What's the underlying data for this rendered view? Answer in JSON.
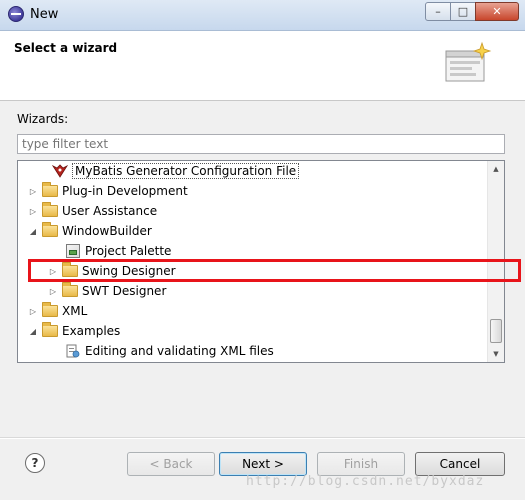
{
  "window": {
    "title": "New",
    "minimize_glyph": "–",
    "restore_glyph": "□",
    "close_glyph": "✕"
  },
  "header": {
    "title": "Select a wizard"
  },
  "wizards": {
    "label": "Wizards:",
    "filter_placeholder": "type filter text",
    "filter_value": ""
  },
  "tree": {
    "items": [
      {
        "label": "MyBatis Generator Configuration File",
        "icon": "mybatis-icon",
        "expander": "",
        "selected": true
      },
      {
        "label": "Plug-in Development",
        "icon": "folder-icon",
        "expander": "▷"
      },
      {
        "label": "User Assistance",
        "icon": "folder-icon",
        "expander": "▷"
      },
      {
        "label": "WindowBuilder",
        "icon": "folder-icon",
        "expander": "◢"
      },
      {
        "label": "Project Palette",
        "icon": "palette-icon",
        "expander": ""
      },
      {
        "label": "Swing Designer",
        "icon": "folder-icon",
        "expander": "▷"
      },
      {
        "label": "SWT Designer",
        "icon": "folder-icon",
        "expander": "▷"
      },
      {
        "label": "XML",
        "icon": "folder-icon",
        "expander": "▷"
      },
      {
        "label": "Examples",
        "icon": "folder-icon",
        "expander": "◢"
      },
      {
        "label": "Editing and validating XML files",
        "icon": "xml-file-icon",
        "expander": ""
      }
    ]
  },
  "buttons": {
    "help": "?",
    "back": "< Back",
    "next": "Next >",
    "finish": "Finish",
    "cancel": "Cancel"
  },
  "watermark": "http://blog.csdn.net/byxdaz",
  "colors": {
    "annotation_red": "#e8141a"
  }
}
